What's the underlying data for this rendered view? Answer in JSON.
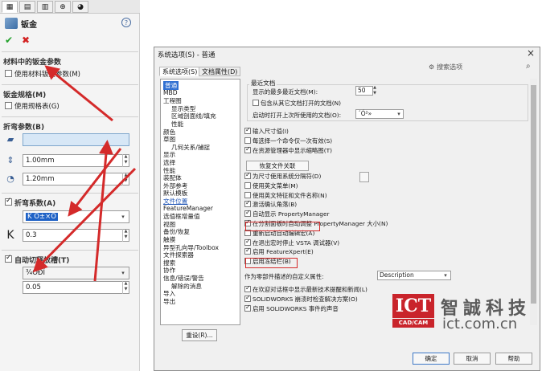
{
  "left_panel": {
    "tabs": [
      "▦",
      "▤",
      "▥",
      "⊕",
      "◕"
    ],
    "title": "钣金",
    "sections": {
      "material_params": {
        "label": "材料中的钣金参数",
        "checkbox_label": "使用材料钣金参数(M)"
      },
      "sheet_gauge": {
        "label": "钣金规格(M)",
        "checkbox_label": "使用规格表(G)"
      },
      "bend_params": {
        "label": "折弯参数(B)",
        "face_value": "",
        "thickness": "1.00mm",
        "radius": "1.20mm"
      },
      "bend_allowance": {
        "label": "折弯系数(A)",
        "type_value": "K Ó±×Ó",
        "k_symbol": "K",
        "k_value": "0.3"
      },
      "auto_relief": {
        "label": "自动切释放槽(T)",
        "type_value": "¾ÓÐÎ",
        "ratio_value": "0.05"
      }
    }
  },
  "dialog": {
    "title": "系统选项(S) - 普通",
    "tabs": [
      "系统选项(S)",
      "文档属性(D)"
    ],
    "search_placeholder": "搜索选项",
    "tree": [
      {
        "label": "普通",
        "selected": true,
        "indent": 0
      },
      {
        "label": "MBD",
        "indent": 0
      },
      {
        "label": "工程图",
        "indent": 0
      },
      {
        "label": "显示类型",
        "indent": 1
      },
      {
        "label": "区域剖面线/填充",
        "indent": 1
      },
      {
        "label": "性能",
        "indent": 1
      },
      {
        "label": "颜色",
        "indent": 0
      },
      {
        "label": "草图",
        "indent": 0
      },
      {
        "label": "几何关系/捕捉",
        "indent": 1
      },
      {
        "label": "显示",
        "indent": 0
      },
      {
        "label": "选择",
        "indent": 0
      },
      {
        "label": "性能",
        "indent": 0
      },
      {
        "label": "装配体",
        "indent": 0
      },
      {
        "label": "外部参考",
        "indent": 0
      },
      {
        "label": "默认模板",
        "indent": 0
      },
      {
        "label": "文件位置",
        "indent": 0,
        "link": true
      },
      {
        "label": "FeatureManager",
        "indent": 0
      },
      {
        "label": "选值框增量值",
        "indent": 0
      },
      {
        "label": "视图",
        "indent": 0
      },
      {
        "label": "备份/恢复",
        "indent": 0
      },
      {
        "label": "触摸",
        "indent": 0
      },
      {
        "label": "异型孔向导/Toolbox",
        "indent": 0
      },
      {
        "label": "文件探索器",
        "indent": 0
      },
      {
        "label": "搜索",
        "indent": 0
      },
      {
        "label": "协作",
        "indent": 0
      },
      {
        "label": "信息/错误/警告",
        "indent": 0
      },
      {
        "label": "解除的消息",
        "indent": 1
      },
      {
        "label": "导入",
        "indent": 0
      },
      {
        "label": "导出",
        "indent": 0
      }
    ],
    "reset_label": "重设(R)...",
    "recent": {
      "group_label": "最近文档",
      "max_label": "显示的最多最近文档(M):",
      "max_value": "50",
      "include_label": "包含从其它文档打开的文档(N)",
      "startup_label": "启动时打开上次所使用的文档(O):",
      "startup_value": "´Ó²»"
    },
    "options": [
      {
        "label": "输入尺寸值(I)",
        "checked": true
      },
      {
        "label": "每选择一个命令仅一次有效(S)",
        "checked": false
      },
      {
        "label": "在资源管理器中显示缩略图(T)",
        "checked": true
      }
    ],
    "associate_button": "恢复文件关联",
    "options2": [
      {
        "label": "为尺寸使用系统分隔符(D)",
        "checked": true
      },
      {
        "label": "使用英文菜单(M)",
        "checked": false
      },
      {
        "label": "使用英文特征和文件名称(N)",
        "checked": false
      },
      {
        "label": "激活确认角落(B)",
        "checked": true
      },
      {
        "label": "自动显示 PropertyManager",
        "checked": true
      },
      {
        "label": "在分割面板时自动调整 PropertyManager 大小(N)",
        "checked": true
      },
      {
        "label": "重新启动自动编辑宏(A)",
        "checked": false
      },
      {
        "label": "在退出宏时停止 VSTA 调试器(V)",
        "checked": true
      },
      {
        "label": "启用 FeatureXpert(E)",
        "checked": true
      },
      {
        "label": "启用冻结栏(B)",
        "checked": false
      }
    ],
    "descriptor_label": "作为零部件描述的自定义属性:",
    "descriptor_value": "Description",
    "options3": [
      {
        "label": "在欢迎对话框中显示最新技术提醒和新闻(L)",
        "checked": true
      },
      {
        "label": "SOLIDWORKS 崩溃时检查解决方案(O)",
        "checked": true
      },
      {
        "label": "启用 SOLIDWORKS 事件的声音",
        "checked": true
      }
    ],
    "buttons": {
      "ok": "确定",
      "cancel": "取消",
      "help": "帮助"
    }
  },
  "watermark": {
    "logo": "ICT",
    "logo_sub": "CAD/CAM",
    "cn_text": "智誠科技",
    "url": "ict.com.cn"
  },
  "colors": {
    "accent": "#d42a2a",
    "selection": "#2f6fd1",
    "logo_red": "#c9242b"
  }
}
